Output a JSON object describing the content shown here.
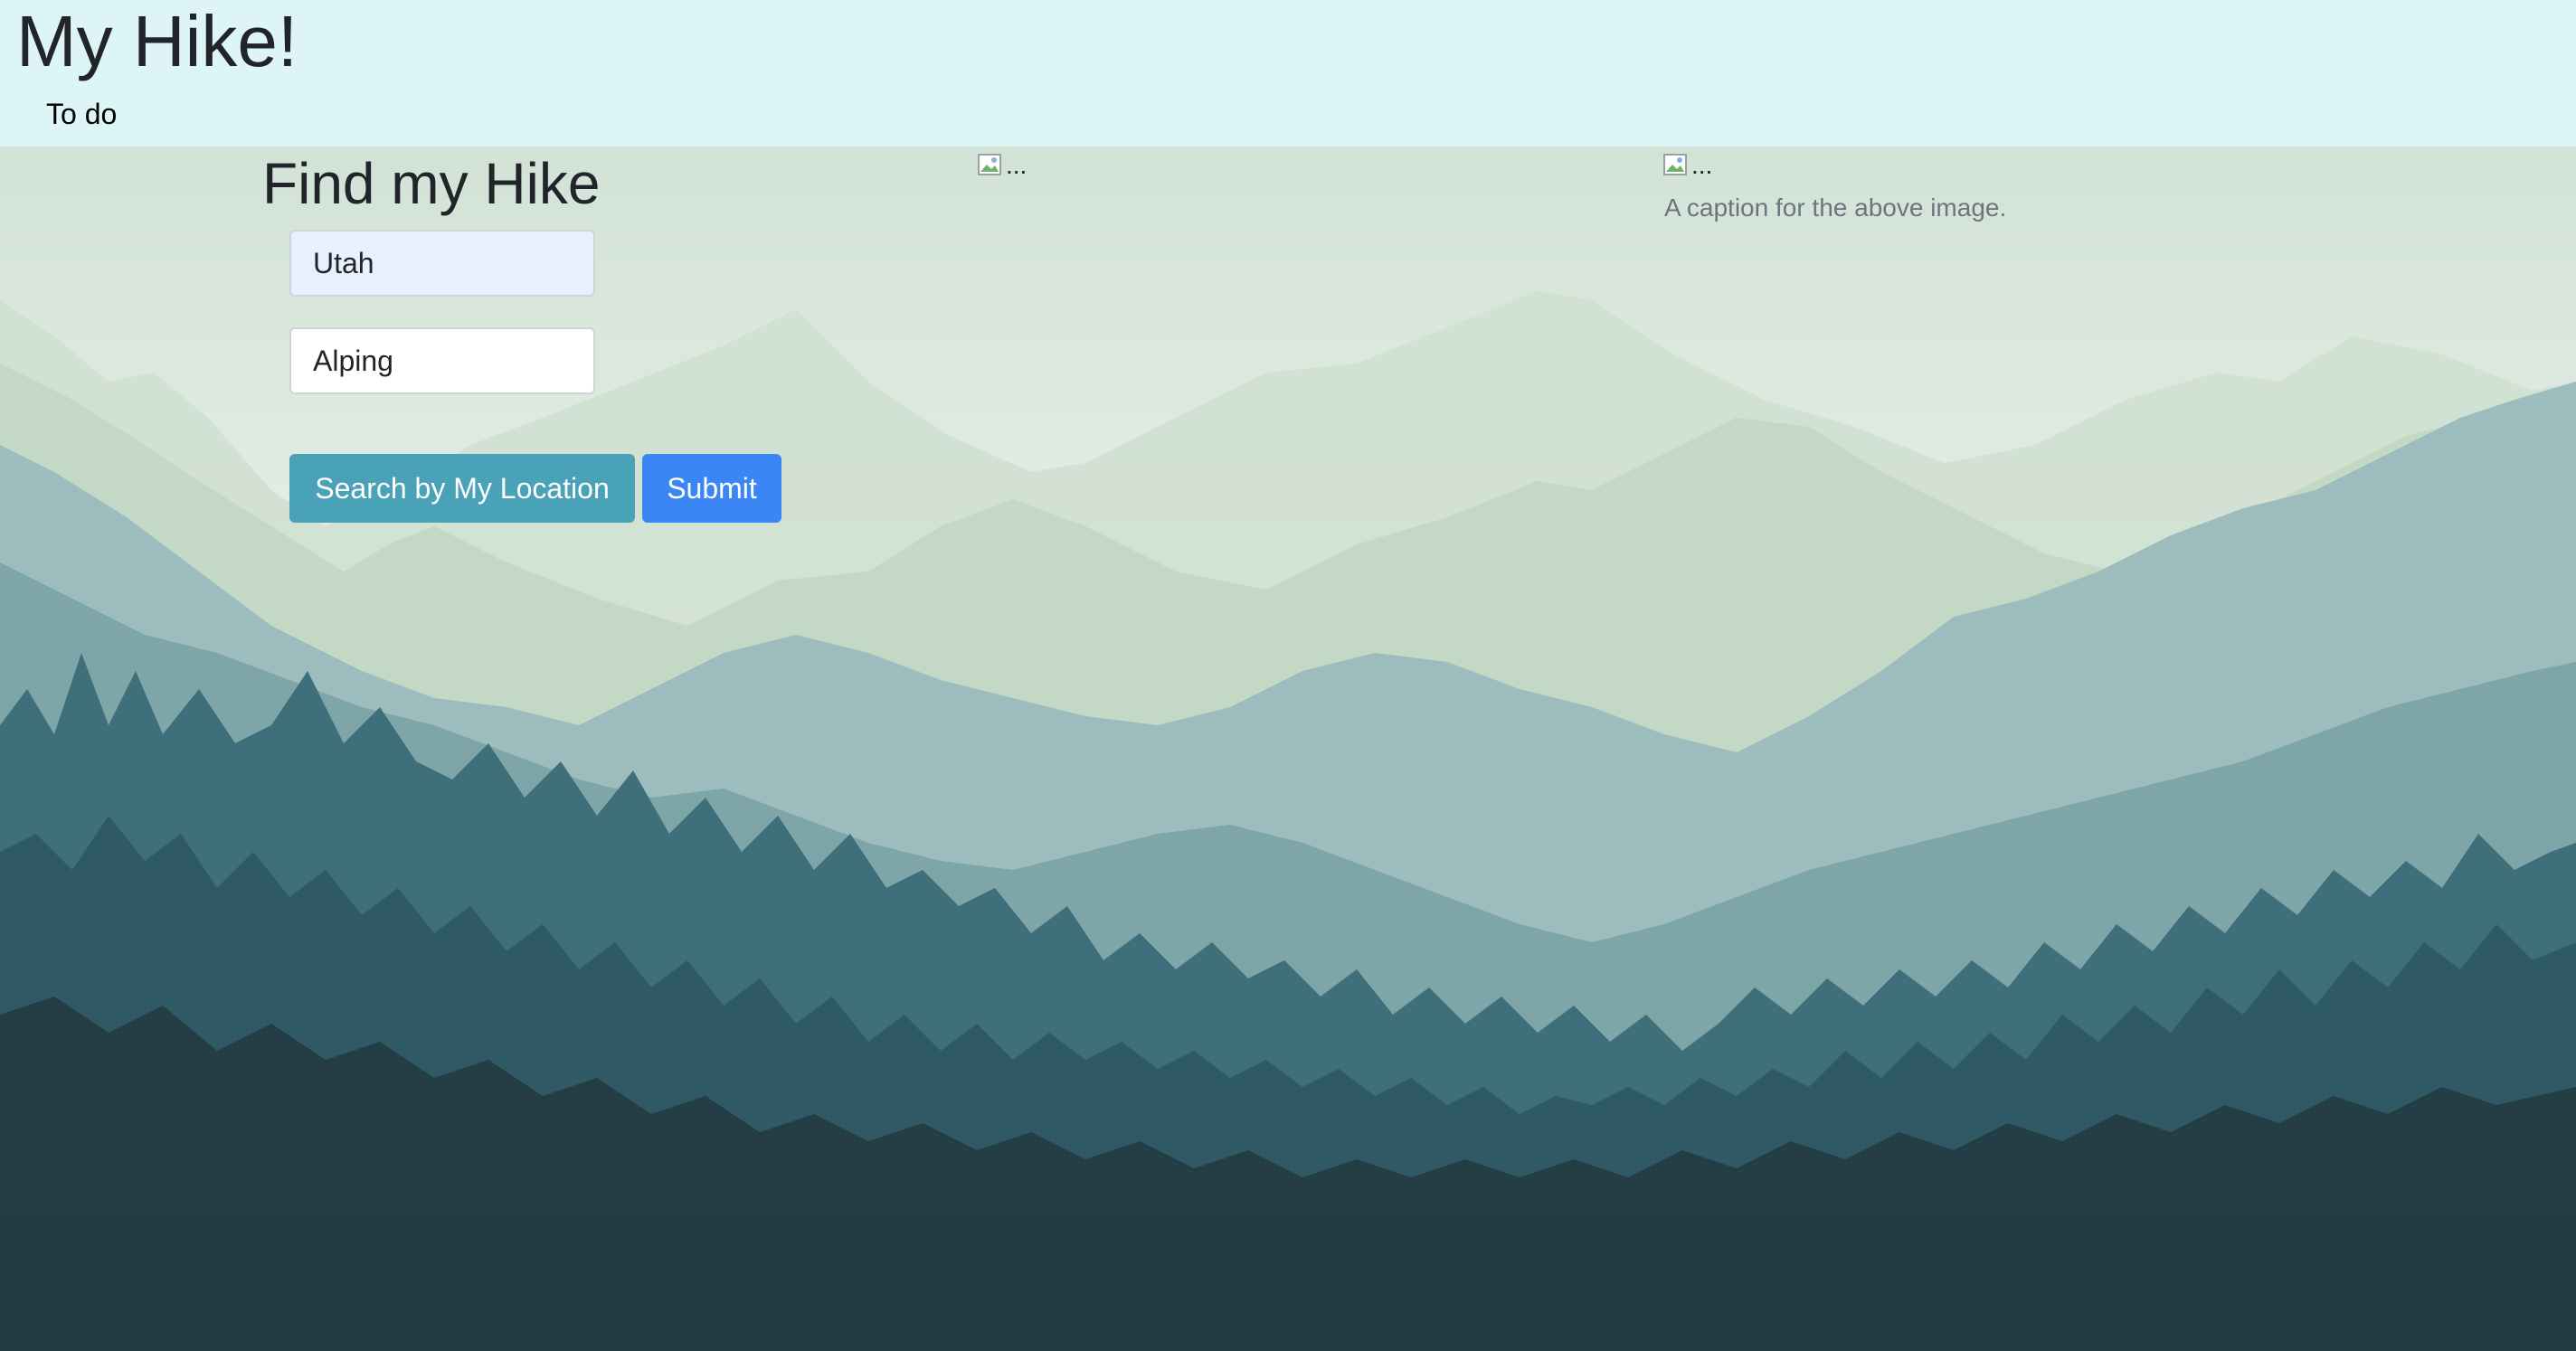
{
  "header": {
    "title": "My Hike!",
    "nav_todo": "To do",
    "background_color": "#ddf5f7"
  },
  "search": {
    "title": "Find my Hike",
    "state_value": "Utah",
    "hike_type_value": "Alping",
    "location_button": "Search by My Location",
    "submit_button": "Submit",
    "location_button_color": "#4aa2b8",
    "submit_button_color": "#3b86f5"
  },
  "gallery": {
    "image1_alt": "...",
    "image2_alt": "...",
    "caption": "A caption for the above image."
  },
  "background": {
    "description_icon": "mountain-forest-icon"
  }
}
